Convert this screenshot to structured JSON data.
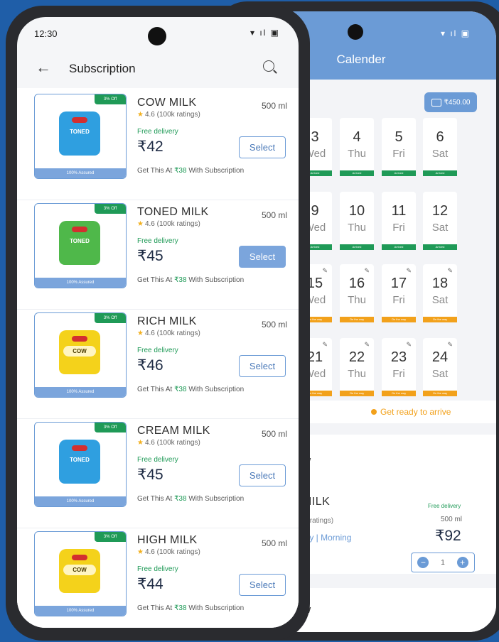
{
  "back_phone": {
    "title": "Calender",
    "wallet": "₹450.00",
    "calendar": [
      {
        "num": "3",
        "day": "Wed",
        "status": "Arrived",
        "kind": "arrived",
        "edit": false
      },
      {
        "num": "4",
        "day": "Thu",
        "status": "Arrived",
        "kind": "arrived",
        "edit": false
      },
      {
        "num": "5",
        "day": "Fri",
        "status": "Arrived",
        "kind": "arrived",
        "edit": false
      },
      {
        "num": "6",
        "day": "Sat",
        "status": "Arrived",
        "kind": "arrived",
        "edit": false
      },
      {
        "num": "9",
        "day": "Wed",
        "status": "Arrived",
        "kind": "arrived",
        "edit": false
      },
      {
        "num": "10",
        "day": "Thu",
        "status": "Arrived",
        "kind": "arrived",
        "edit": false
      },
      {
        "num": "11",
        "day": "Fri",
        "status": "Arrived",
        "kind": "arrived",
        "edit": false
      },
      {
        "num": "12",
        "day": "Sat",
        "status": "Arrived",
        "kind": "arrived",
        "edit": false
      },
      {
        "num": "15",
        "day": "Wed",
        "status": "On the way",
        "kind": "ontheway",
        "edit": true
      },
      {
        "num": "16",
        "day": "Thu",
        "status": "On the way",
        "kind": "ontheway",
        "edit": true
      },
      {
        "num": "17",
        "day": "Fri",
        "status": "On the way",
        "kind": "ontheway",
        "edit": true
      },
      {
        "num": "18",
        "day": "Sat",
        "status": "On the way",
        "kind": "ontheway",
        "edit": true
      },
      {
        "num": "21",
        "day": "Wed",
        "status": "On the way",
        "kind": "ontheway",
        "edit": true
      },
      {
        "num": "22",
        "day": "Thu",
        "status": "On the way",
        "kind": "ontheway",
        "edit": true
      },
      {
        "num": "23",
        "day": "Fri",
        "status": "On the way",
        "kind": "ontheway",
        "edit": true
      },
      {
        "num": "24",
        "day": "Sat",
        "status": "On the way",
        "kind": "ontheway",
        "edit": true
      }
    ],
    "legend_left": "d",
    "legend_right": "Get ready to arrive",
    "tomorrow_heading": "rrow",
    "tomorrow_product": "H MILK",
    "tomorrow_rating": "(100k ratings)",
    "tomorrow_plan": "t Daily  | Morning",
    "tomorrow_free": "Free delivery",
    "tomorrow_size": "500 ml",
    "tomorrow_price": "₹92",
    "qty_minus": "−",
    "qty": "1",
    "qty_plus": "+",
    "tomorrow_heading2": "rrow"
  },
  "status_bar": {
    "time": "12:30",
    "icons": "▾ ıl ▣"
  },
  "header": {
    "back": "←",
    "title": "Subscription"
  },
  "products": [
    {
      "name": "COW MILK",
      "size": "500 ml",
      "rating": "4.6 (100k ratings)",
      "free": "Free delivery",
      "price": "₹42",
      "button": "Select",
      "active": false,
      "off": "3% Off",
      "assured": "100% Assured",
      "sub_prefix": "Get This At ",
      "sub_price": "₹38",
      "sub_suffix": " With Subscription",
      "pack_color": "blue",
      "pack_label": "TONED"
    },
    {
      "name": "TONED MILK",
      "size": "500 ml",
      "rating": "4.6 (100k ratings)",
      "free": "Free delivery",
      "price": "₹45",
      "button": "Select",
      "active": true,
      "off": "3% Off",
      "assured": "100% Assured",
      "sub_prefix": "Get This At ",
      "sub_price": "₹38",
      "sub_suffix": " With Subscription",
      "pack_color": "green",
      "pack_label": "TONED"
    },
    {
      "name": "RICH MILK",
      "size": "500 ml",
      "rating": "4.6 (100k ratings)",
      "free": "Free delivery",
      "price": "₹46",
      "button": "Select",
      "active": false,
      "off": "3% Off",
      "assured": "100% Assured",
      "sub_prefix": "Get This At ",
      "sub_price": "₹38",
      "sub_suffix": " With Subscription",
      "pack_color": "yellow",
      "pack_label": "COW"
    },
    {
      "name": "CREAM MILK",
      "size": "500 ml",
      "rating": "4.6 (100k ratings)",
      "free": "Free delivery",
      "price": "₹45",
      "button": "Select",
      "active": false,
      "off": "3% Off",
      "assured": "100% Assured",
      "sub_prefix": "Get This At ",
      "sub_price": "₹38",
      "sub_suffix": " With Subscription",
      "pack_color": "blue",
      "pack_label": "TONED"
    },
    {
      "name": "HIGH MILK",
      "size": "500 ml",
      "rating": "4.6 (100k ratings)",
      "free": "Free delivery",
      "price": "₹44",
      "button": "Select",
      "active": false,
      "off": "3% Off",
      "assured": "100% Assured",
      "sub_prefix": "Get This At ",
      "sub_price": "₹38",
      "sub_suffix": " With Subscription",
      "pack_color": "yellow",
      "pack_label": "COW"
    }
  ]
}
